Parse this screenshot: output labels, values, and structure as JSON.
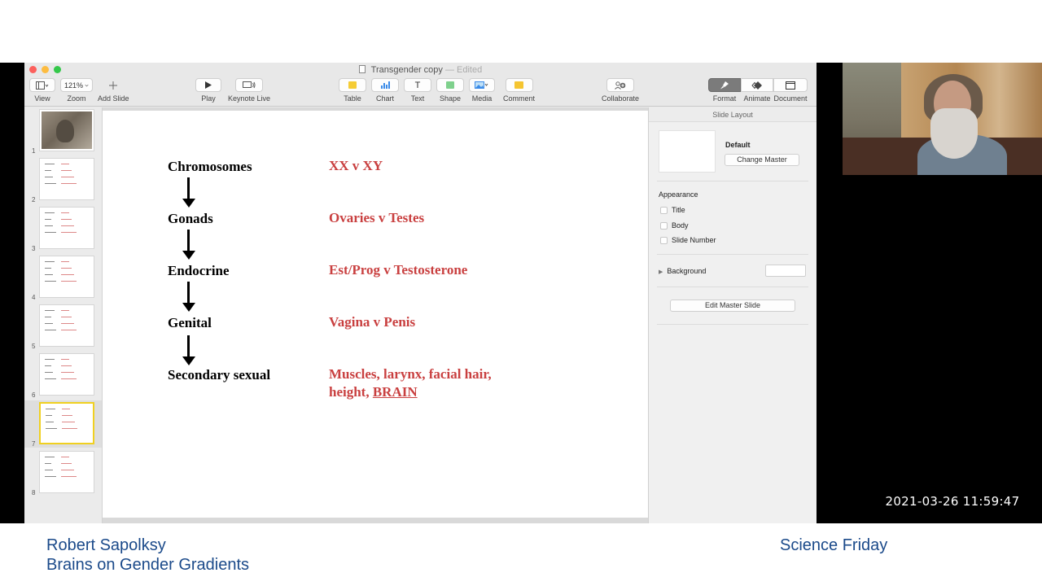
{
  "window": {
    "title": "Transgender copy",
    "status": "— Edited"
  },
  "toolbar": {
    "view_label": "View",
    "zoom_value": "121%",
    "zoom_label": "Zoom",
    "add_slide_label": "Add Slide",
    "play_label": "Play",
    "keynote_live_label": "Keynote Live",
    "table_label": "Table",
    "chart_label": "Chart",
    "text_label": "Text",
    "text_glyph": "T",
    "shape_label": "Shape",
    "media_label": "Media",
    "comment_label": "Comment",
    "collaborate_label": "Collaborate",
    "format_label": "Format",
    "animate_label": "Animate",
    "document_label": "Document"
  },
  "navigator": {
    "slides": [
      {
        "number": "1",
        "kind": "photo",
        "selected": false
      },
      {
        "number": "2",
        "kind": "text",
        "selected": false
      },
      {
        "number": "3",
        "kind": "text",
        "selected": false
      },
      {
        "number": "4",
        "kind": "text",
        "selected": false
      },
      {
        "number": "5",
        "kind": "text",
        "selected": false
      },
      {
        "number": "6",
        "kind": "text",
        "selected": false
      },
      {
        "number": "7",
        "kind": "text",
        "selected": true
      },
      {
        "number": "8",
        "kind": "text",
        "selected": false
      }
    ]
  },
  "slide": {
    "rows": [
      {
        "stage": "Chromosomes",
        "value": "XX  v  XY"
      },
      {
        "stage": "Gonads",
        "value": "Ovaries v Testes"
      },
      {
        "stage": "Endocrine",
        "value": "Est/Prog v Testosterone"
      },
      {
        "stage": "Genital",
        "value": "Vagina v Penis"
      },
      {
        "stage": "Secondary sexual",
        "value": "Muscles, larynx, facial hair,",
        "value2": "height, ",
        "value2_underlined": "BRAIN"
      }
    ]
  },
  "inspector": {
    "header": "Slide Layout",
    "layout_name": "Default",
    "change_master_label": "Change Master",
    "appearance_label": "Appearance",
    "title_label": "Title",
    "body_label": "Body",
    "slide_number_label": "Slide Number",
    "background_label": "Background",
    "edit_master_label": "Edit Master Slide"
  },
  "overlay": {
    "timestamp": "2021-03-26 11:59:47"
  },
  "captions": {
    "speaker_name": "Robert Sapolksy",
    "episode_title": "Brains on Gender Gradients",
    "brand": "Science Friday"
  },
  "colors": {
    "slide_red": "#c94040",
    "caption_blue": "#1b4a8a"
  }
}
